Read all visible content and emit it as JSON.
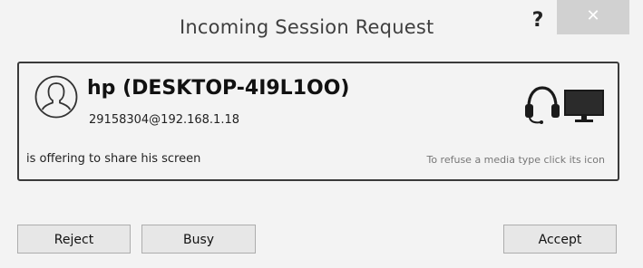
{
  "dialog": {
    "title": "Incoming Session Request",
    "help_label": "?",
    "close_label": "✕"
  },
  "request": {
    "name": "hp (DESKTOP-4I9L1OO)",
    "address": "29158304@192.168.1.18",
    "message": "is offering to share his screen",
    "hint": "To refuse a media type click its icon",
    "media_icons": [
      "headset-icon",
      "monitor-icon"
    ]
  },
  "buttons": {
    "reject": "Reject",
    "busy": "Busy",
    "accept": "Accept"
  }
}
